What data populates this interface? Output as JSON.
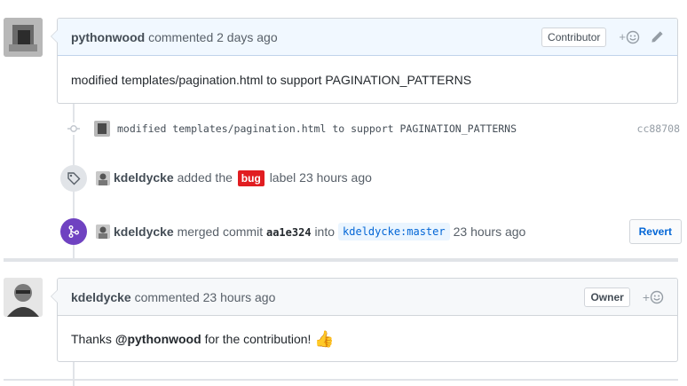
{
  "comment1": {
    "author": "pythonwood",
    "action": "commented 2 days ago",
    "badge": "Contributor",
    "reaction_label": "+",
    "body": "modified templates/pagination.html to support PAGINATION_PATTERNS",
    "icons": [
      "smiley-icon",
      "pencil-icon"
    ]
  },
  "commit": {
    "message": "modified templates/pagination.html to support PAGINATION_PATTERNS",
    "sha": "cc88708",
    "icons": [
      "git-commit-icon"
    ]
  },
  "label_event": {
    "actor": "kdeldycke",
    "text_before": "added the",
    "label": "bug",
    "text_after": "label 23 hours ago",
    "label_color": "#e11d21",
    "icons": [
      "tag-icon"
    ]
  },
  "merge_event": {
    "actor": "kdeldycke",
    "text_before": "merged commit",
    "sha": "aa1e324",
    "text_middle": "into",
    "branch": "kdeldycke:master",
    "time": "23 hours ago",
    "revert_label": "Revert",
    "badge_color": "#6f42c1",
    "icons": [
      "git-merge-icon"
    ]
  },
  "comment2": {
    "author": "kdeldycke",
    "action": "commented 23 hours ago",
    "badge": "Owner",
    "reaction_label": "+",
    "body_before": "Thanks",
    "mention": "@pythonwood",
    "body_after": "for the contribution!",
    "emoji": "👍",
    "icons": [
      "smiley-icon",
      "thumbs-up-icon"
    ]
  }
}
